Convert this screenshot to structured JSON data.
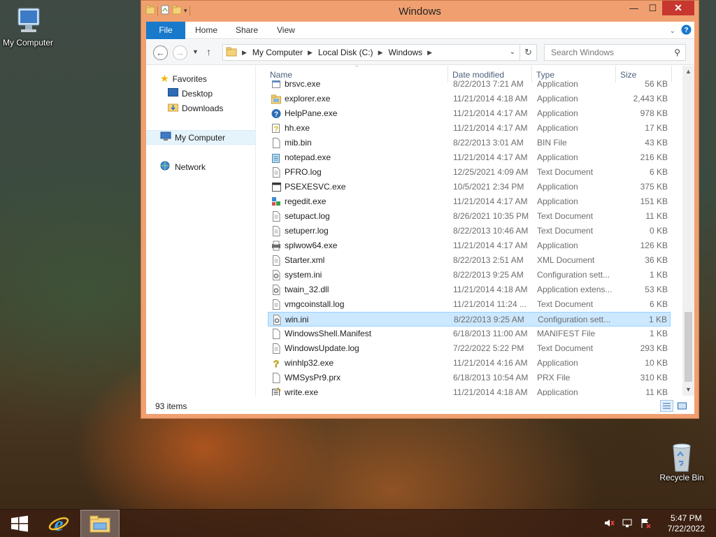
{
  "desktop": {
    "icons": [
      {
        "label": "My Computer"
      },
      {
        "label": "Recycle Bin"
      }
    ]
  },
  "window": {
    "title": "Windows",
    "buttons": {
      "minimize": "—",
      "maximize": "☐",
      "close": "✕"
    }
  },
  "ribbon": {
    "tabs": [
      "File",
      "Home",
      "Share",
      "View"
    ]
  },
  "address": {
    "crumbs": [
      "My Computer",
      "Local Disk (C:)",
      "Windows"
    ],
    "search_placeholder": "Search Windows"
  },
  "nav": {
    "favorites": "Favorites",
    "desktop": "Desktop",
    "downloads": "Downloads",
    "my_computer": "My Computer",
    "network": "Network"
  },
  "columns": {
    "name": "Name",
    "date": "Date modified",
    "type": "Type",
    "size": "Size"
  },
  "files": [
    {
      "name": "brsvc.exe",
      "date": "8/22/2013 7:21 AM",
      "type": "Application",
      "size": "56 KB",
      "icon": "app"
    },
    {
      "name": "explorer.exe",
      "date": "11/21/2014 4:18 AM",
      "type": "Application",
      "size": "2,443 KB",
      "icon": "folder-app"
    },
    {
      "name": "HelpPane.exe",
      "date": "11/21/2014 4:17 AM",
      "type": "Application",
      "size": "978 KB",
      "icon": "help"
    },
    {
      "name": "hh.exe",
      "date": "11/21/2014 4:17 AM",
      "type": "Application",
      "size": "17 KB",
      "icon": "help-doc"
    },
    {
      "name": "mib.bin",
      "date": "8/22/2013 3:01 AM",
      "type": "BIN File",
      "size": "43 KB",
      "icon": "file"
    },
    {
      "name": "notepad.exe",
      "date": "11/21/2014 4:17 AM",
      "type": "Application",
      "size": "216 KB",
      "icon": "notepad"
    },
    {
      "name": "PFRO.log",
      "date": "12/25/2021 4:09 AM",
      "type": "Text Document",
      "size": "6 KB",
      "icon": "text"
    },
    {
      "name": "PSEXESVC.exe",
      "date": "10/5/2021 2:34 PM",
      "type": "Application",
      "size": "375 KB",
      "icon": "window-app"
    },
    {
      "name": "regedit.exe",
      "date": "11/21/2014 4:17 AM",
      "type": "Application",
      "size": "151 KB",
      "icon": "regedit"
    },
    {
      "name": "setupact.log",
      "date": "8/26/2021 10:35 PM",
      "type": "Text Document",
      "size": "11 KB",
      "icon": "text"
    },
    {
      "name": "setuperr.log",
      "date": "8/22/2013 10:46 AM",
      "type": "Text Document",
      "size": "0 KB",
      "icon": "text"
    },
    {
      "name": "splwow64.exe",
      "date": "11/21/2014 4:17 AM",
      "type": "Application",
      "size": "126 KB",
      "icon": "printer"
    },
    {
      "name": "Starter.xml",
      "date": "8/22/2013 2:51 AM",
      "type": "XML Document",
      "size": "36 KB",
      "icon": "text"
    },
    {
      "name": "system.ini",
      "date": "8/22/2013 9:25 AM",
      "type": "Configuration sett...",
      "size": "1 KB",
      "icon": "config"
    },
    {
      "name": "twain_32.dll",
      "date": "11/21/2014 4:18 AM",
      "type": "Application extens...",
      "size": "53 KB",
      "icon": "config"
    },
    {
      "name": "vmgcoinstall.log",
      "date": "11/21/2014 11:24 ...",
      "type": "Text Document",
      "size": "6 KB",
      "icon": "text"
    },
    {
      "name": "win.ini",
      "date": "8/22/2013 9:25 AM",
      "type": "Configuration sett...",
      "size": "1 KB",
      "icon": "config",
      "selected": true
    },
    {
      "name": "WindowsShell.Manifest",
      "date": "6/18/2013 11:00 AM",
      "type": "MANIFEST File",
      "size": "1 KB",
      "icon": "file"
    },
    {
      "name": "WindowsUpdate.log",
      "date": "7/22/2022 5:22 PM",
      "type": "Text Document",
      "size": "293 KB",
      "icon": "text"
    },
    {
      "name": "winhlp32.exe",
      "date": "11/21/2014 4:16 AM",
      "type": "Application",
      "size": "10 KB",
      "icon": "help-q"
    },
    {
      "name": "WMSysPr9.prx",
      "date": "6/18/2013 10:54 AM",
      "type": "PRX File",
      "size": "310 KB",
      "icon": "file"
    },
    {
      "name": "write.exe",
      "date": "11/21/2014 4:18 AM",
      "type": "Application",
      "size": "11 KB",
      "icon": "write"
    }
  ],
  "status": {
    "item_count": "93 items"
  },
  "taskbar": {
    "time": "5:47 PM",
    "date": "7/22/2022"
  },
  "colors": {
    "window_frame": "#f0a070",
    "accent": "#1979ca",
    "selection": "#cce8ff",
    "close": "#c7372f"
  }
}
